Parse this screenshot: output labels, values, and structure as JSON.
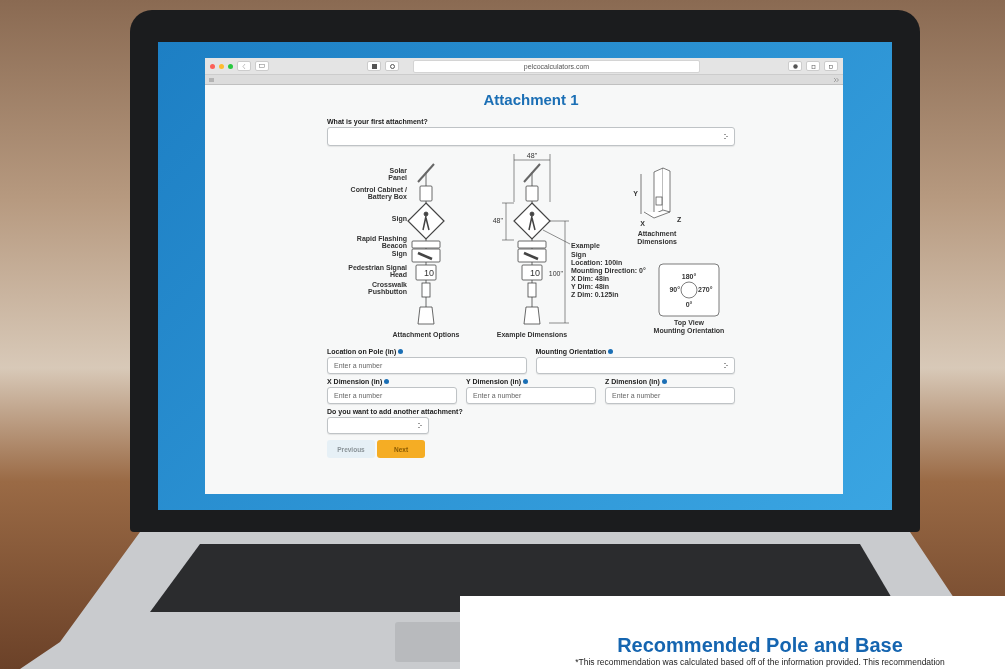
{
  "browser": {
    "url": "pelcocalculators.com"
  },
  "page": {
    "title": "Attachment 1",
    "first_attachment": {
      "label": "What is your first attachment?"
    },
    "diagram": {
      "option_labels": [
        "Solar Panel",
        "Control Cabinet / Battery Box",
        "Sign",
        "Rapid Flashing Beacon",
        "Sign",
        "Pedestrian Signal Head",
        "Crosswalk Pushbutton"
      ],
      "options_signal": "10",
      "example_signal": "10",
      "options_caption": "Attachment Options",
      "example_caption": "Example Dimensions",
      "width_dim": "48\"",
      "height_dim": "48\"",
      "location_dim": "100\"",
      "example_note": "Example",
      "example_lines": [
        "Sign",
        "Location: 100in",
        "Mounting Direction: 0°",
        "X Dim: 48in",
        "Y Dim: 48in",
        "Z Dim: 0.125in"
      ],
      "axis_labels": [
        "Y",
        "X",
        "Z"
      ],
      "dimensions_caption": [
        "Attachment",
        "Dimensions"
      ],
      "angles": [
        "180°",
        "90°",
        "270°",
        "0°"
      ],
      "orientation_caption": [
        "Top View",
        "Mounting Orientation"
      ]
    },
    "field_rows": [
      [
        {
          "label": "Location on Pole (in)",
          "kind": "number",
          "placeholder": "Enter a number"
        },
        {
          "label": "Mounting Orientation",
          "kind": "select"
        }
      ],
      [
        {
          "label": "X Dimension (in)",
          "kind": "number",
          "placeholder": "Enter a number"
        },
        {
          "label": "Y Dimension (in)",
          "kind": "number",
          "placeholder": "Enter a number"
        },
        {
          "label": "Z Dimension (in)",
          "kind": "number",
          "placeholder": "Enter a number"
        }
      ]
    ],
    "another": {
      "label": "Do you want to add another attachment?"
    },
    "buttons": [
      {
        "label": "Previous",
        "kind": "secondary"
      },
      {
        "label": "Next",
        "kind": "primary"
      }
    ]
  },
  "overlay": {
    "title": "Recommended Pole and Base",
    "note": "*This recommendation was calculated based off of the information provided. This recommendation"
  }
}
